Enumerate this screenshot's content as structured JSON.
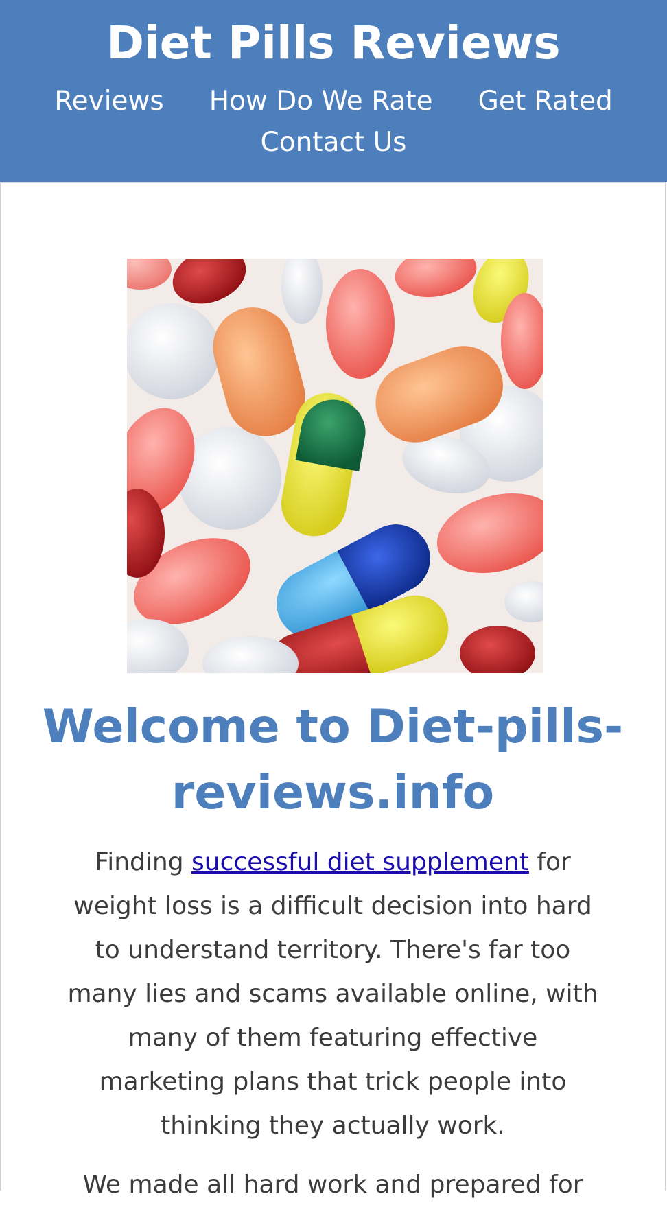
{
  "header": {
    "site_title": "Diet Pills Reviews",
    "nav": {
      "reviews": "Reviews",
      "how_rate": "How Do We Rate",
      "get_rated": "Get Rated",
      "contact": "Contact Us"
    }
  },
  "main": {
    "heading": "Welcome to Diet-pills-reviews.info",
    "intro": {
      "before": "Finding ",
      "link": "successful diet supplement",
      "after": " for weight loss is a difficult decision into hard to understand territory. There's far too many lies and scams available online, with many of them featuring effective marketing plans that trick people into thinking they actually work."
    },
    "next_paragraph": "We made all hard work and prepared for"
  },
  "colors": {
    "header_bg": "#4d7fbd",
    "heading": "#4d7fbd",
    "link": "#1a0dab",
    "body_text": "#3c3c3c"
  }
}
